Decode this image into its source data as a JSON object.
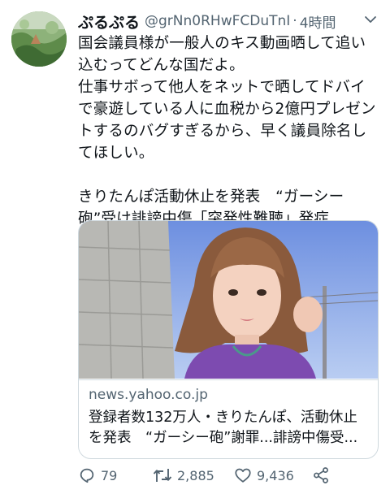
{
  "tweet": {
    "author": {
      "display_name": "ぷるぷる",
      "handle": "@grNn0RHwFCDuTnI",
      "separator": "·",
      "time": "4時間"
    },
    "text": "国会議員様が一般人のキス動画晒して追い\n込むってどんな国だよ。\n仕事サボって他人をネットで晒してドバイ\nで豪遊している人に血税から2億円プレゼン\nトするのバグすぎるから、早く議員除名し\nてほしい。\n\nきりたんぽ活動休止を発表　“ガーシー\n砲”受け誹謗中傷「突発性難聴」発症",
    "card": {
      "domain": "news.yahoo.co.jp",
      "title": "登録者数132万人・きりたんぽ、活動休止\nを発表　“ガーシー砲”謝罪...誹謗中傷受..."
    },
    "actions": {
      "replies": "79",
      "retweets": "2,885",
      "likes": "9,436"
    },
    "icons": {
      "more": "more-icon",
      "reply": "reply-icon",
      "retweet": "retweet-icon",
      "like": "heart-icon",
      "share": "share-icon"
    }
  },
  "colors": {
    "text": "#0f1419",
    "secondary": "#536471",
    "border": "#cfd9de"
  }
}
